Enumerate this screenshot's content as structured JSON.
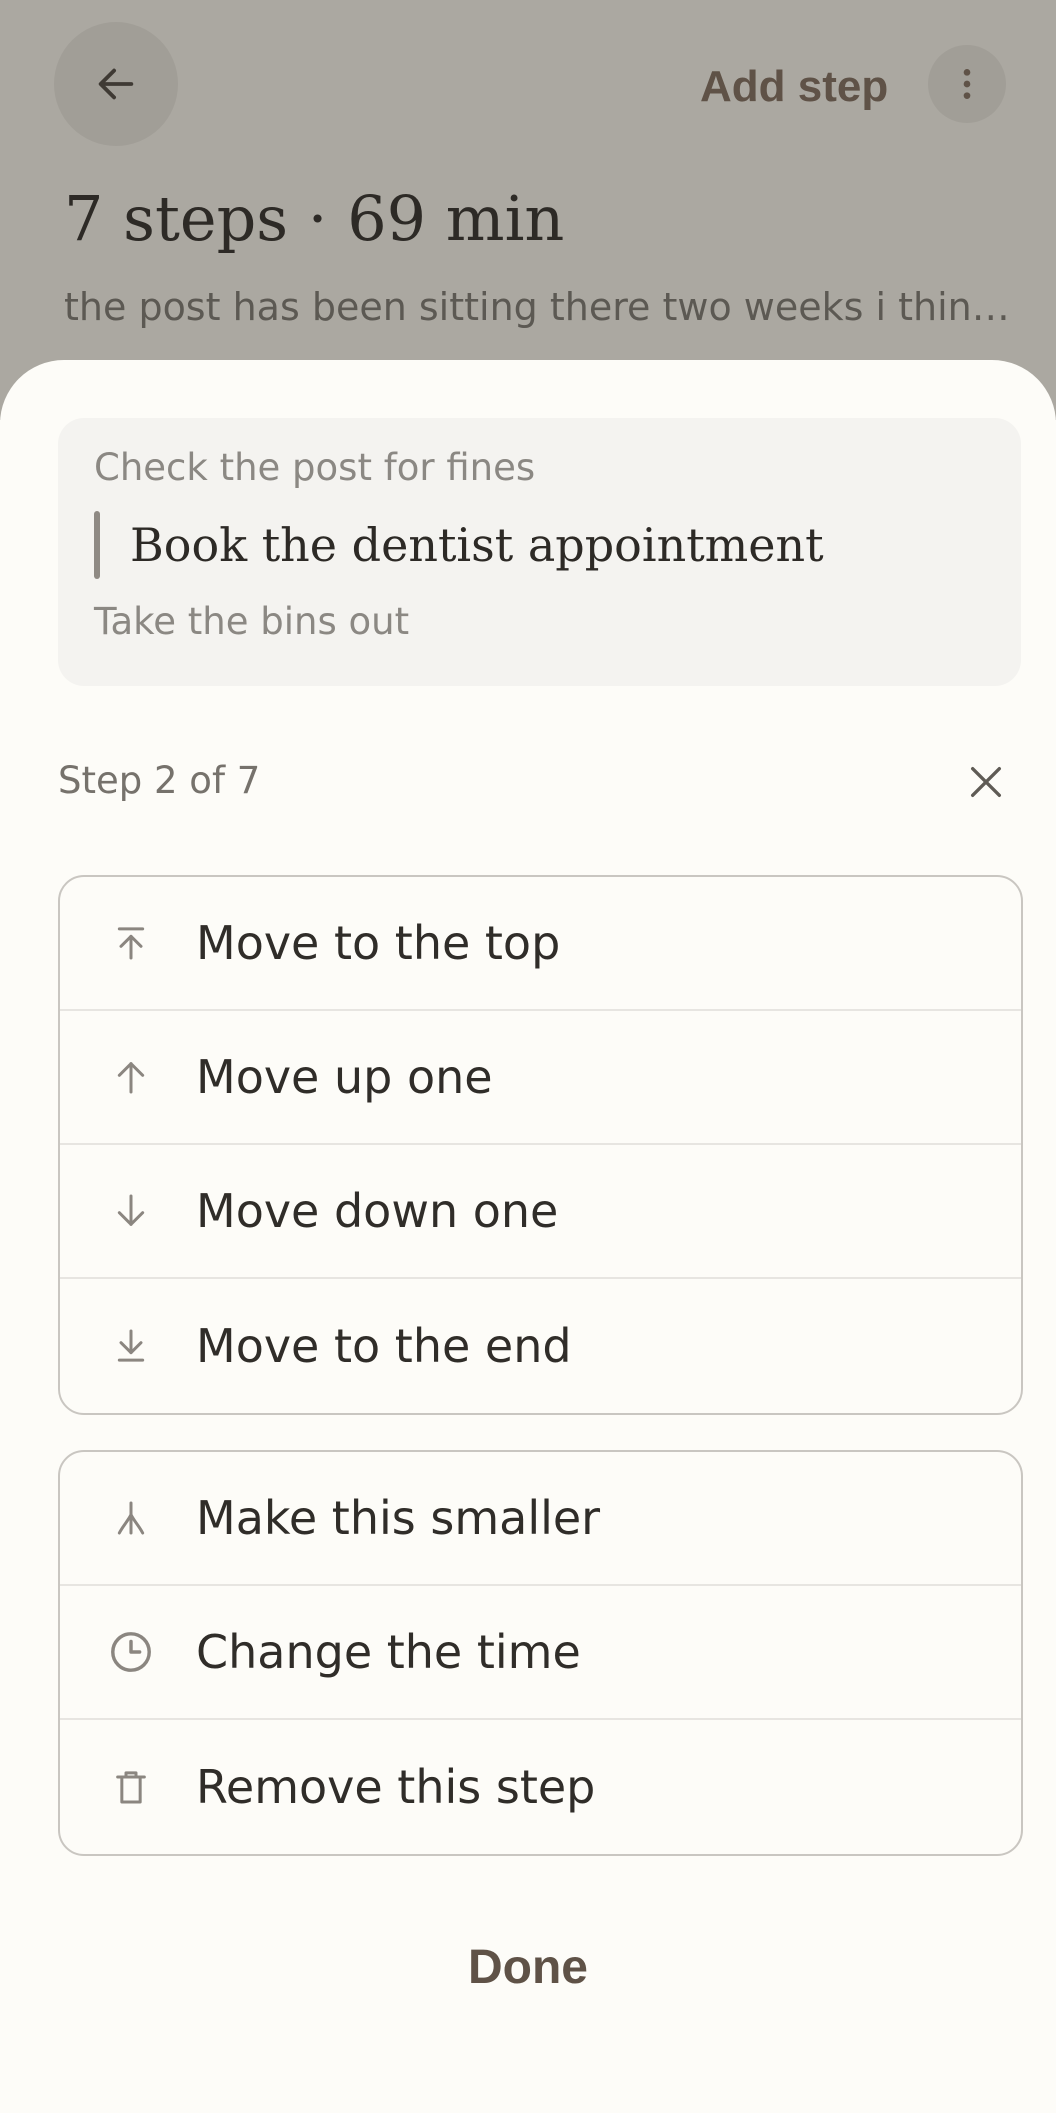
{
  "header": {
    "back_icon": "arrow-left-icon",
    "add_step_label": "Add step",
    "more_icon": "more-vertical-icon",
    "title": "7 steps · 69 min",
    "description": "the post has been sitting there two weeks i think o..."
  },
  "sheet": {
    "preview": {
      "previous_step": "Check the post for fines",
      "current_step": "Book the dentist appointment",
      "next_step": "Take the bins out"
    },
    "step_position": "Step 2 of 7",
    "close_icon": "close-icon",
    "move_actions": [
      {
        "label": "Move to the top",
        "icon": "arrow-to-top-icon"
      },
      {
        "label": "Move up one",
        "icon": "arrow-up-icon"
      },
      {
        "label": "Move down one",
        "icon": "arrow-down-icon"
      },
      {
        "label": "Move to the end",
        "icon": "arrow-to-bottom-icon"
      }
    ],
    "edit_actions": [
      {
        "label": "Make this smaller",
        "icon": "split-icon"
      },
      {
        "label": "Change the time",
        "icon": "clock-icon"
      },
      {
        "label": "Remove this step",
        "icon": "trash-icon"
      }
    ],
    "done_label": "Done"
  },
  "colors": {
    "background_dim": "#aba8a1",
    "sheet": "#fdfcf8",
    "accent_text": "#5f5247",
    "border": "#c9c6c1"
  }
}
